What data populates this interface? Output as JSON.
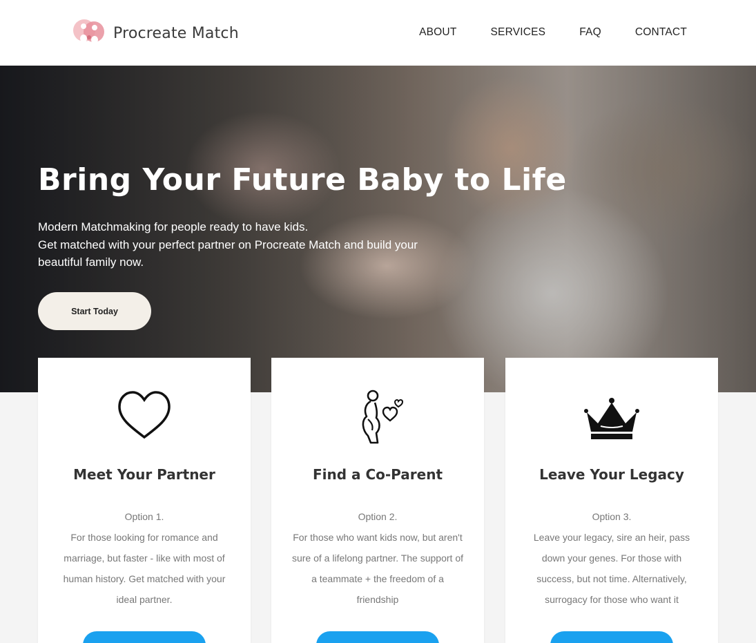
{
  "brand": {
    "name": "Procreate Match"
  },
  "nav": {
    "items": [
      {
        "label": "ABOUT"
      },
      {
        "label": "SERVICES"
      },
      {
        "label": "FAQ"
      },
      {
        "label": "CONTACT"
      }
    ]
  },
  "hero": {
    "title": "Bring Your Future Baby to Life",
    "subtitle_lines": [
      "Modern Matchmaking for people ready to have kids.",
      "Get matched with your perfect partner on Procreate Match and build your beautiful family now."
    ],
    "cta_label": "Start Today"
  },
  "cards": [
    {
      "icon": "heart-outline-icon",
      "title": "Meet Your Partner",
      "option": "Option 1.",
      "description": "For those looking for romance and marriage, but faster - like with most of human history. Get matched with your ideal partner."
    },
    {
      "icon": "pregnant-woman-hearts-icon",
      "title": "Find a Co-Parent",
      "option": "Option 2.",
      "description": "For those who want kids now, but aren't sure of a lifelong partner. The support of a teammate + the freedom of a friendship"
    },
    {
      "icon": "crown-icon",
      "title": "Leave Your Legacy",
      "option": "Option 3.",
      "description": "Leave your legacy, sire an heir, pass down your genes. For those with success, but not time. Alternatively, surrogacy for those who want it"
    }
  ],
  "colors": {
    "accent_blue": "#1aa1ef",
    "logo_pink": "#e8909c",
    "text_dark": "#333333",
    "text_muted": "#777777"
  }
}
